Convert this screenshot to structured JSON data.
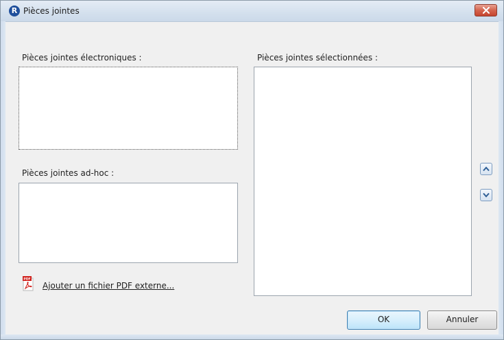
{
  "window": {
    "title": "Pièces jointes",
    "app_icon_letter": "R"
  },
  "electronic": {
    "label": "Pièces jointes électroniques :"
  },
  "adhoc": {
    "label": "Pièces jointes ad-hoc :"
  },
  "selected": {
    "label": "Pièces jointes sélectionnées :"
  },
  "external_pdf": {
    "icon_text": "PDF",
    "link_label": "Ajouter un fichier PDF externe..."
  },
  "buttons": {
    "ok": "OK",
    "cancel": "Annuler"
  },
  "colors": {
    "close_button": "#c6452f",
    "app_icon": "#1f4f9c",
    "pdf_icon": "#d0201b"
  }
}
